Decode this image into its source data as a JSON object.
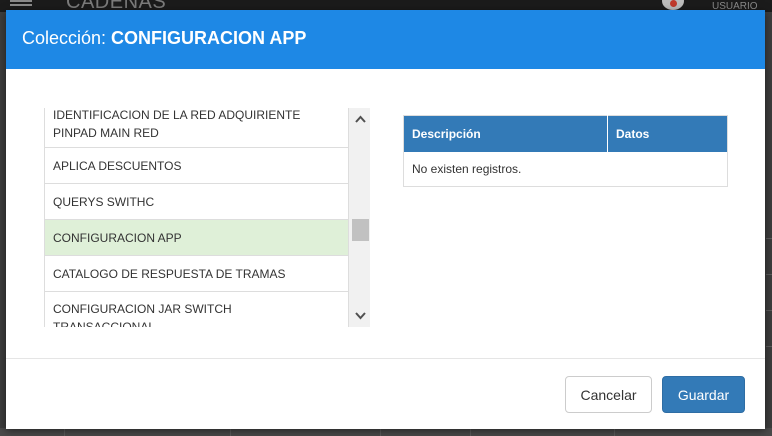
{
  "background": {
    "app_title": "CADENAS",
    "user_label": "USUARIO"
  },
  "modal": {
    "title_prefix": "Colección: ",
    "title_name": "CONFIGURACION APP"
  },
  "collection_list": {
    "items": [
      {
        "lines": [
          "IDENTIFICACION DE LA RED ADQUIRIENTE",
          "PINPAD MAIN RED"
        ],
        "selected": false
      },
      {
        "lines": [
          "APLICA DESCUENTOS"
        ],
        "selected": false
      },
      {
        "lines": [
          "QUERYS SWITHC"
        ],
        "selected": false
      },
      {
        "lines": [
          "CONFIGURACION APP"
        ],
        "selected": true
      },
      {
        "lines": [
          "CATALOGO DE RESPUESTA DE TRAMAS"
        ],
        "selected": false
      },
      {
        "lines": [
          "CONFIGURACION JAR SWITCH",
          "TRANSACCIONAL"
        ],
        "selected": false
      }
    ],
    "scroll_position": 0.58
  },
  "data_table": {
    "columns": [
      "Descripción",
      "Datos"
    ],
    "empty_message": "No existen registros."
  },
  "footer": {
    "cancel_label": "Cancelar",
    "save_label": "Guardar"
  },
  "colors": {
    "header": "#1e88e5",
    "table_header": "#337ab7",
    "selected_row": "#dff0d8",
    "primary_button": "#337ab7"
  },
  "icons": {
    "scroll_up": "chevron-up-icon",
    "scroll_down": "chevron-down-icon"
  }
}
